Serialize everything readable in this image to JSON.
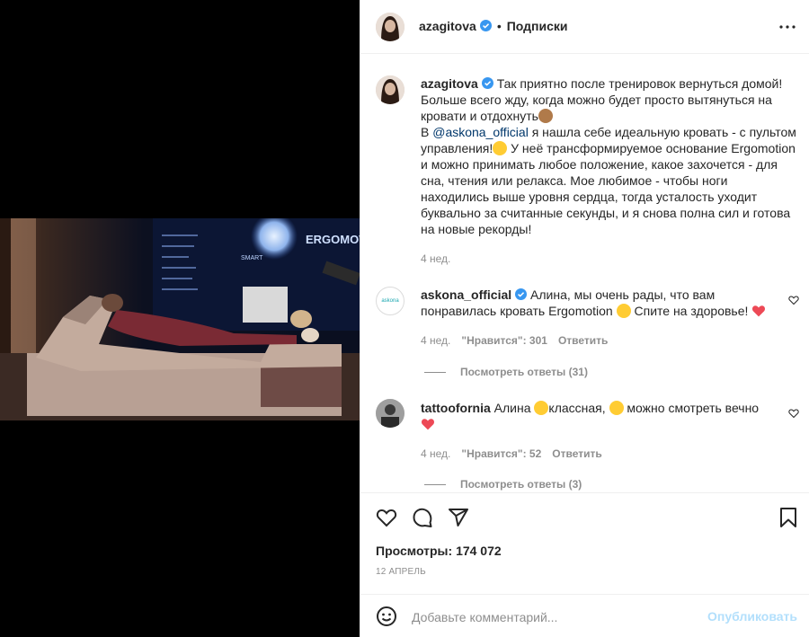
{
  "post": {
    "author": "azagitova",
    "header_follow": "Подписки",
    "dot": "•",
    "caption_lines": [
      "Так приятно после тренировок вернуться домой!",
      "Больше всего жду, когда можно будет просто вытянуться на",
      "кровати и отдохнуть",
      "я нашла себе идеальную кровать - с пультом",
      "управления!",
      "У неё трансформируемое основание Ergomotion",
      "и можно принимать любое положение, какое захочется - для",
      "сна, чтения или релакса. Мое любимое - чтобы ноги",
      "находились выше уровня сердца, тогда усталость уходит",
      "буквально за считанные секунды, и я снова полна сил и готова",
      "на новые рекорды!"
    ],
    "caption_prefix_v": "В",
    "caption_mention": "@askona_official",
    "caption_time": "4 нед."
  },
  "comments": [
    {
      "author": "askona_official",
      "text_line1": "Алина, мы очень рады, что вам",
      "text_line2a": "понравилась кровать Ergomotion",
      "text_line2b": "Спите на здоровье!",
      "time": "4 нед.",
      "likes": "\"Нравится\": 301",
      "reply": "Ответить",
      "view_replies": "Посмотреть ответы (31)",
      "avatar_text": "askona"
    },
    {
      "author": "tattoofornia",
      "text_a": "Алина",
      "text_b": "классная,",
      "text_c": "можно смотреть вечно",
      "time": "4 нед.",
      "likes": "\"Нравится\": 52",
      "reply": "Ответить",
      "view_replies": "Посмотреть ответы (3)"
    }
  ],
  "actions": {
    "views_label": "Просмотры:",
    "views_value": "174 072",
    "date": "12 АПРЕЛЬ"
  },
  "add_comment": {
    "placeholder": "Добавьте комментарий...",
    "publish": "Опубликовать"
  },
  "video": {
    "brand_text": "ERGOMOTI",
    "smart_text": "SMART"
  },
  "colors": {
    "verified": "#3897f0",
    "link": "#00376b",
    "muted": "#8e8e8e",
    "publish_disabled": "#b2dffc",
    "heart_red": "#ed4956"
  },
  "icons": [
    "more-icon",
    "heart-icon",
    "comment-icon",
    "share-icon",
    "bookmark-icon",
    "emoji-icon",
    "verified-icon"
  ]
}
